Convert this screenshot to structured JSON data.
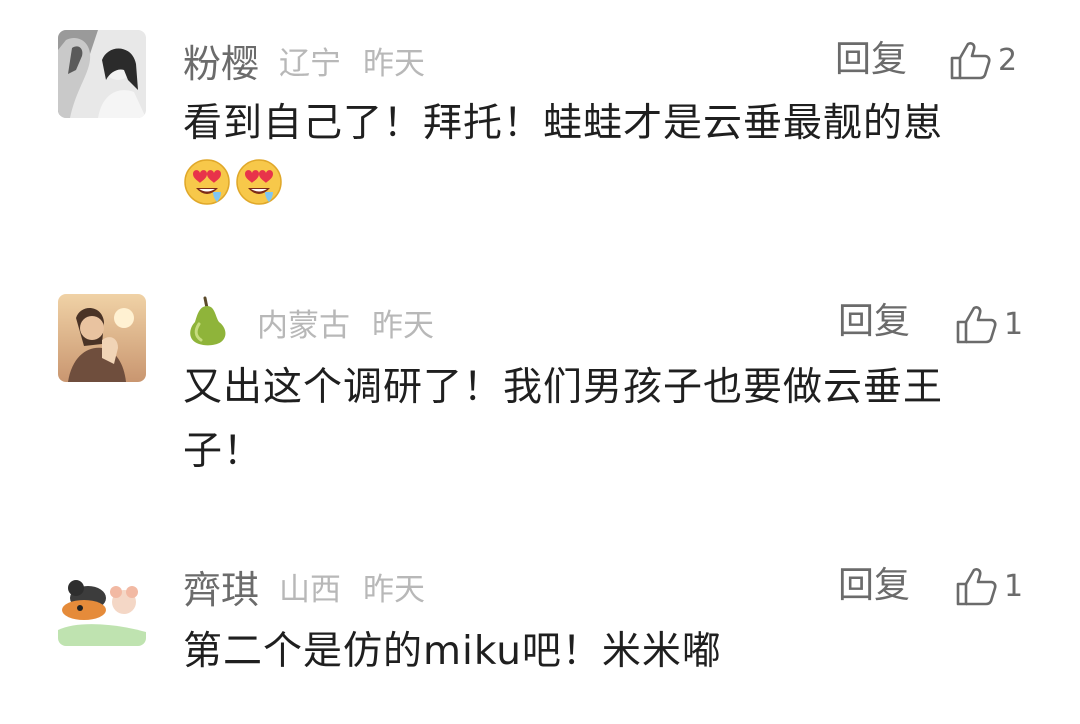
{
  "comments": [
    {
      "nickname": "粉樱",
      "region": "辽宁",
      "time": "昨天",
      "reply_label": "回复",
      "likes": "2",
      "avatar": "woman-with-horse-avatar",
      "content": "看到自己了！拜托！蛙蛙才是云垂最靓的崽",
      "emojis": [
        "heart-eyes-emoji",
        "heart-eyes-emoji"
      ]
    },
    {
      "nickname_icon": "pear-icon",
      "region": "内蒙古",
      "time": "昨天",
      "reply_label": "回复",
      "likes": "1",
      "avatar": "sunset-couple-avatar",
      "content_line1": "又出这个调研了！我们男孩子也要做云垂王",
      "content_line2": "子！"
    },
    {
      "nickname": "齊琪",
      "region": "山西",
      "time": "昨天",
      "reply_label": "回复",
      "likes": "1",
      "avatar": "cartoon-cat-mouse-avatar",
      "content": "第二个是仿的miku吧！米米嘟"
    }
  ],
  "colors": {
    "text_primary": "#1f1f1f",
    "text_secondary": "#6b6b6b",
    "text_muted": "#b8b8b8"
  }
}
